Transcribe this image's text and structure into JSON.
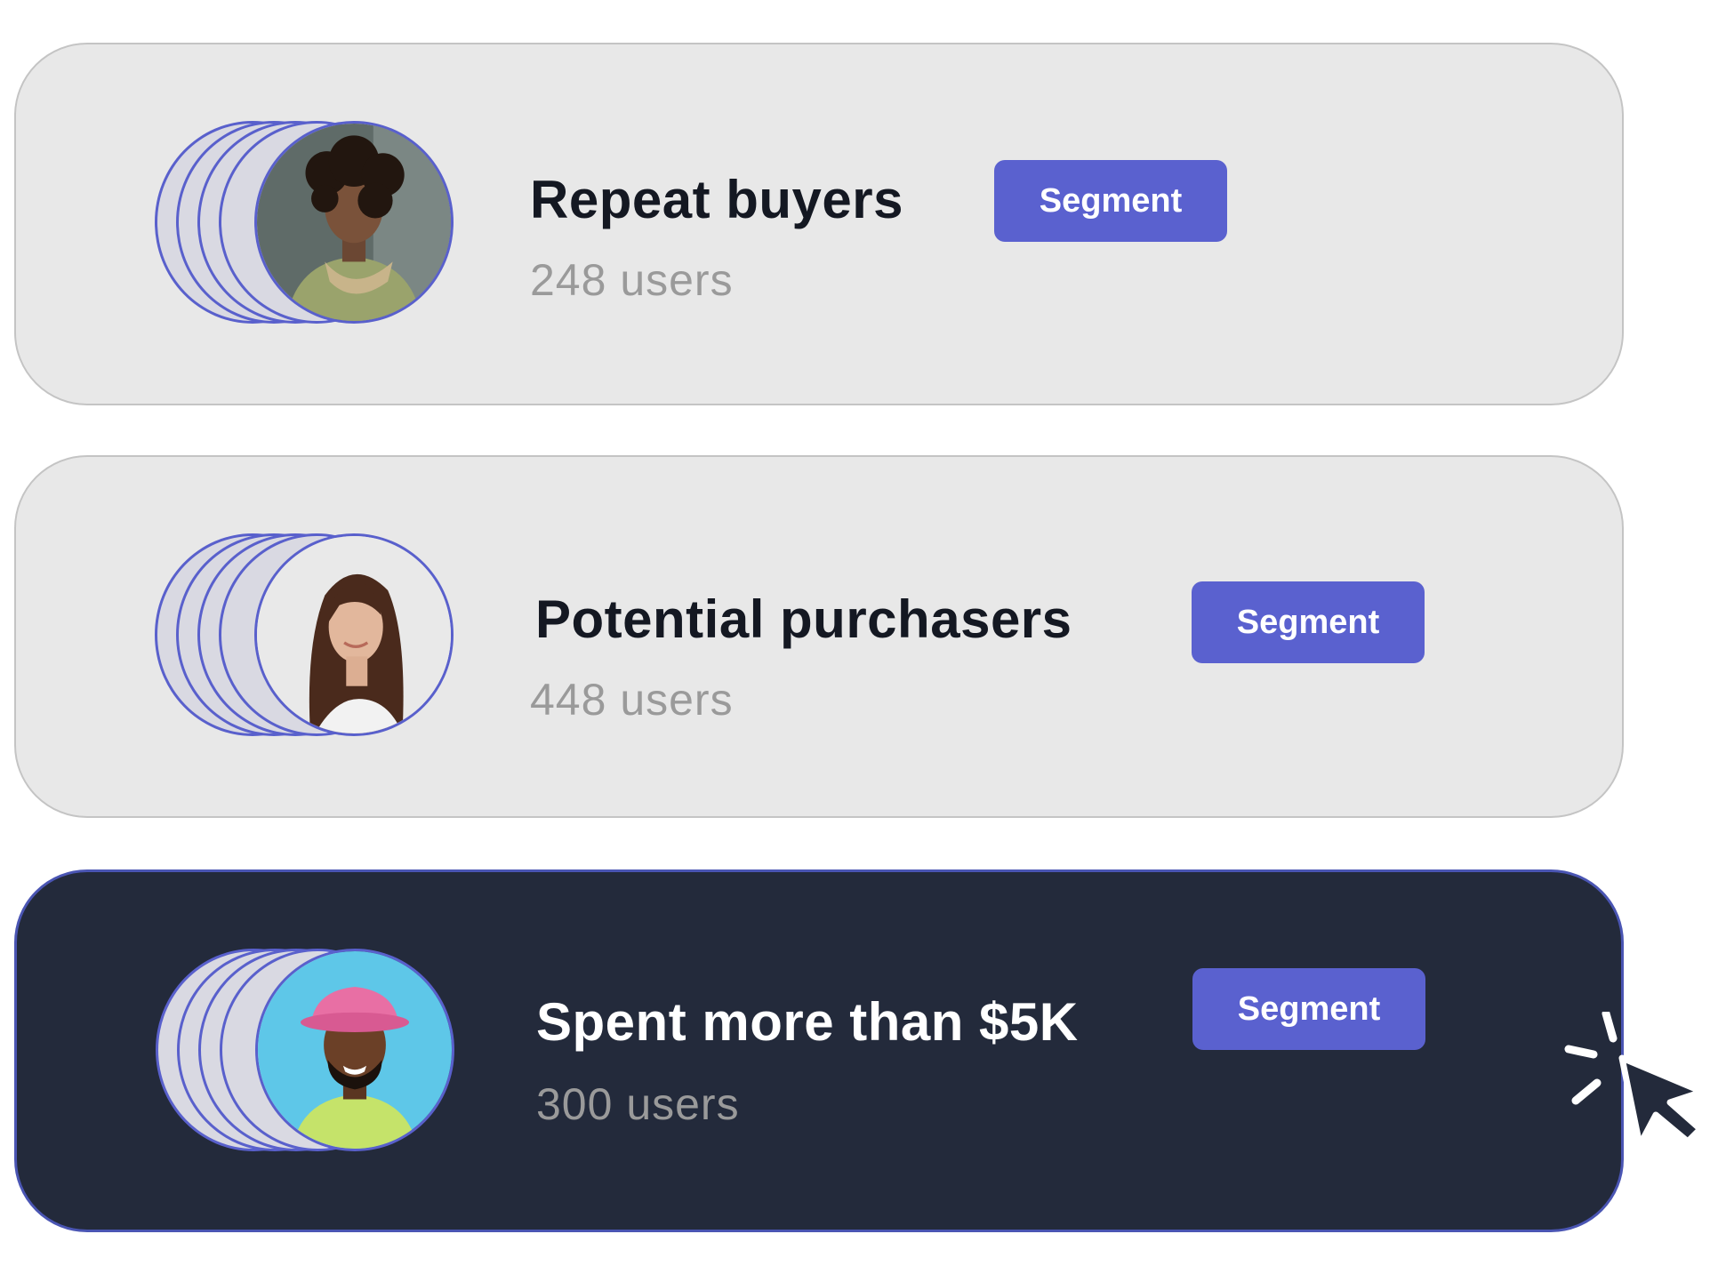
{
  "segments": [
    {
      "title": "Repeat buyers",
      "count": "248 users",
      "badge": "Segment",
      "avatar": "woman-curly-hair-avatar"
    },
    {
      "title": "Potential purchasers",
      "count": "448 users",
      "badge": "Segment",
      "avatar": "woman-long-hair-avatar"
    },
    {
      "title": "Spent more than $5K",
      "count": "300 users",
      "badge": "Segment",
      "avatar": "man-pink-hat-avatar"
    }
  ],
  "colors": {
    "accent": "#5a61cf",
    "card_light": "#e8e8e8",
    "card_dark": "#232a3b",
    "muted_text": "#9a9a9a"
  },
  "icons": {
    "cursor": "click-cursor-icon"
  }
}
